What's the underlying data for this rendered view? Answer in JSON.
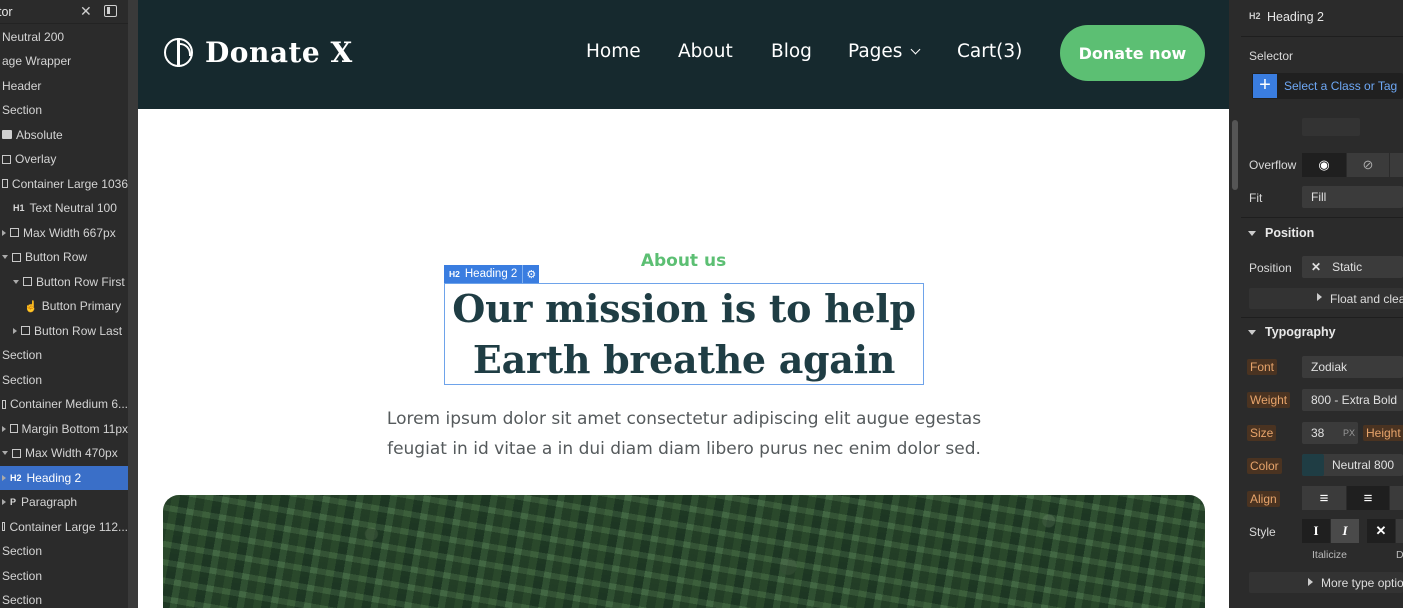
{
  "navigator": {
    "title": "tor",
    "items": [
      {
        "label": "Neutral 200",
        "indent": 0,
        "arrow": "",
        "kind": "none"
      },
      {
        "label": "age Wrapper",
        "indent": 0,
        "arrow": "",
        "kind": "none"
      },
      {
        "label": "Header",
        "indent": 0,
        "arrow": "",
        "kind": "none"
      },
      {
        "label": "Section",
        "indent": 0,
        "arrow": "",
        "kind": "none"
      },
      {
        "label": "Absolute",
        "indent": 0,
        "arrow": "",
        "kind": "img"
      },
      {
        "label": "Overlay",
        "indent": 0,
        "arrow": "",
        "kind": "box"
      },
      {
        "label": "Container Large 1036",
        "indent": 0,
        "arrow": "",
        "kind": "box"
      },
      {
        "label": "Text Neutral 100",
        "indent": 1,
        "arrow": "",
        "kind": "h1"
      },
      {
        "label": "Max Width 667px",
        "indent": 0,
        "arrow": "r",
        "kind": "box"
      },
      {
        "label": "Button Row",
        "indent": 0,
        "arrow": "d",
        "kind": "box"
      },
      {
        "label": "Button Row First",
        "indent": 1,
        "arrow": "d",
        "kind": "box"
      },
      {
        "label": "Button Primary",
        "indent": 2,
        "arrow": "",
        "kind": "hand"
      },
      {
        "label": "Button Row Last",
        "indent": 1,
        "arrow": "r",
        "kind": "box"
      },
      {
        "label": "Section",
        "indent": 0,
        "arrow": "",
        "kind": "none"
      },
      {
        "label": "Section",
        "indent": 0,
        "arrow": "",
        "kind": "none"
      },
      {
        "label": "Container Medium 6...",
        "indent": 0,
        "arrow": "",
        "kind": "box"
      },
      {
        "label": "Margin Bottom 11px",
        "indent": 0,
        "arrow": "r",
        "kind": "box"
      },
      {
        "label": "Max Width 470px",
        "indent": 0,
        "arrow": "d",
        "kind": "box"
      },
      {
        "label": "Heading 2",
        "indent": 0,
        "arrow": "r",
        "kind": "h2",
        "selected": true
      },
      {
        "label": "Paragraph",
        "indent": 0,
        "arrow": "r",
        "kind": "p"
      },
      {
        "label": "Container Large 112...",
        "indent": 0,
        "arrow": "",
        "kind": "box"
      },
      {
        "label": "Section",
        "indent": 0,
        "arrow": "",
        "kind": "none"
      },
      {
        "label": "Section",
        "indent": 0,
        "arrow": "",
        "kind": "none"
      },
      {
        "label": "Section",
        "indent": 0,
        "arrow": "",
        "kind": "none"
      }
    ]
  },
  "site": {
    "brand": "Donate X",
    "menu": {
      "home": "Home",
      "about": "About",
      "blog": "Blog",
      "pages": "Pages",
      "cart": "Cart(3)"
    },
    "cta": "Donate now",
    "eyebrow": "About us",
    "heading_line1": "Our mission is to help",
    "heading_line2": "Earth breathe again",
    "paragraph_line1": "Lorem ipsum dolor sit amet consectetur adipiscing elit augue egestas",
    "paragraph_line2": "feugiat in id vitae a in dui diam diam libero purus nec enim dolor sed.",
    "selection_tag": "Heading 2",
    "selection_tag_type": "H2"
  },
  "panel": {
    "element_type": "H2",
    "element_name": "Heading 2",
    "selector_label": "Selector",
    "selector_placeholder": "Select a Class or Tag",
    "overflow_label": "Overflow",
    "fit_label": "Fit",
    "fit_value": "Fill",
    "position_section": "Position",
    "position_label": "Position",
    "position_value": "Static",
    "float_label": "Float and clea",
    "typography_section": "Typography",
    "font_label": "Font",
    "font_value": "Zodiak",
    "weight_label": "Weight",
    "weight_value": "800 - Extra Bold",
    "size_label": "Size",
    "size_value": "38",
    "size_unit": "PX",
    "height_label": "Height",
    "color_label": "Color",
    "color_value": "Neutral 800",
    "color_swatch": "#1f3d44",
    "align_label": "Align",
    "style_label": "Style",
    "italicize_label": "Italicize",
    "decoration_label": "D",
    "more_type": "More type optio"
  }
}
